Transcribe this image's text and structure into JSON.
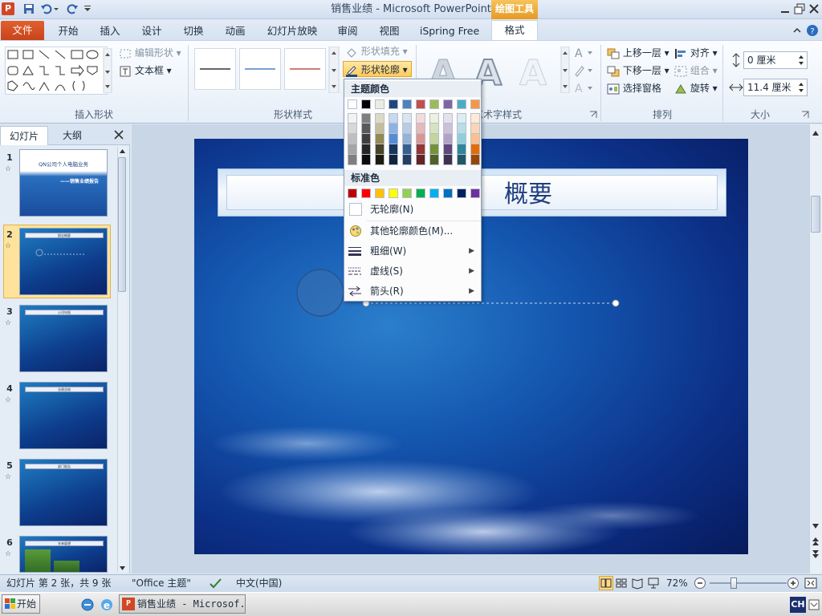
{
  "window": {
    "title": "销售业绩  -  Microsoft PowerPoint",
    "context_tab_group": "绘图工具"
  },
  "tabs": [
    "文件",
    "开始",
    "插入",
    "设计",
    "切换",
    "动画",
    "幻灯片放映",
    "审阅",
    "视图",
    "iSpring Free",
    "格式"
  ],
  "ribbon": {
    "insert_shapes": {
      "label": "插入形状",
      "edit_shape": "编辑形状",
      "text_box": "文本框"
    },
    "shape_styles": {
      "label": "形状样式",
      "fill": "形状填充",
      "outline": "形状轮廓"
    },
    "wordart": {
      "label": "艺术字样式"
    },
    "arrange": {
      "label": "排列",
      "bring_forward": "上移一层",
      "send_backward": "下移一层",
      "selection_pane": "选择窗格",
      "align": "对齐",
      "group": "组合",
      "rotate": "旋转"
    },
    "size": {
      "label": "大小",
      "height": "0 厘米",
      "width": "11.4 厘米"
    }
  },
  "panel": {
    "tab_slides": "幻灯片",
    "tab_outline": "大纲"
  },
  "slides": [
    {
      "num": "1",
      "title": "QN公司个人电脑业务",
      "subtitle": "——销售业绩报告"
    },
    {
      "num": "2",
      "title": "报告概要"
    },
    {
      "num": "3",
      "title": "公司年报"
    },
    {
      "num": "4",
      "title": "业绩总结"
    },
    {
      "num": "5",
      "title": "部门报告"
    },
    {
      "num": "6",
      "title": "未来展望"
    }
  ],
  "slide_main": {
    "title_partial": "概要"
  },
  "dropdown": {
    "theme_header": "主题颜色",
    "standard_header": "标准色",
    "theme_colors": [
      "#ffffff",
      "#000000",
      "#eeece1",
      "#1f497d",
      "#4f81bd",
      "#c0504d",
      "#9bbb59",
      "#8064a2",
      "#4bacc6",
      "#f79646"
    ],
    "theme_shades": [
      [
        "#f2f2f2",
        "#7f7f7f",
        "#ddd9c3",
        "#c6d9f0",
        "#dbe5f1",
        "#f2dcdb",
        "#ebf1dd",
        "#e5e0ec",
        "#dbeef3",
        "#fdeada"
      ],
      [
        "#d8d8d8",
        "#595959",
        "#c4bd97",
        "#8db3e2",
        "#b8cce4",
        "#e5b9b7",
        "#d7e3bc",
        "#ccc1d9",
        "#b7dde8",
        "#fbd5b5"
      ],
      [
        "#bfbfbf",
        "#3f3f3f",
        "#938953",
        "#548dd4",
        "#95b3d7",
        "#d99694",
        "#c3d69b",
        "#b2a2c7",
        "#92cddc",
        "#fac08f"
      ],
      [
        "#a5a5a5",
        "#262626",
        "#494429",
        "#17365d",
        "#366092",
        "#953734",
        "#76923c",
        "#5f497a",
        "#31859b",
        "#e36c09"
      ],
      [
        "#7f7f7f",
        "#0c0c0c",
        "#1d1b10",
        "#0f243e",
        "#244061",
        "#632423",
        "#4f6128",
        "#3f3151",
        "#205867",
        "#974806"
      ]
    ],
    "standard_colors": [
      "#c00000",
      "#ff0000",
      "#ffc000",
      "#ffff00",
      "#92d050",
      "#00b050",
      "#00b0f0",
      "#0070c0",
      "#002060",
      "#7030a0"
    ],
    "no_outline": "无轮廓(N)",
    "more_colors": "其他轮廓颜色(M)...",
    "weight": "粗细(W)",
    "dashes": "虚线(S)",
    "arrows": "箭头(R)"
  },
  "status": {
    "slide_info": "幻灯片 第 2 张，共 9 张",
    "theme": "\"Office 主题\"",
    "language": "中文(中国)",
    "zoom": "72%"
  },
  "taskbar": {
    "start": "开始",
    "task": "销售业绩 - Microsof...",
    "ime": "CH"
  }
}
